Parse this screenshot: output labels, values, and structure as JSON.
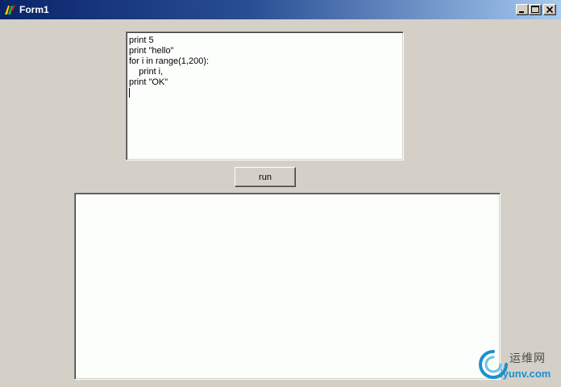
{
  "window": {
    "title": "Form1"
  },
  "caption_buttons": {
    "minimize_icon": "minimize-icon",
    "maximize_icon": "maximize-icon",
    "close_icon": "close-icon"
  },
  "editor": {
    "lines": [
      "print 5",
      "print \"hello\"",
      "for i in range(1,200):",
      "    print i,",
      "print \"OK\"",
      ""
    ]
  },
  "run_button": {
    "label": "run"
  },
  "output": {
    "text": ""
  },
  "watermark": {
    "text_cn": "运维网",
    "url": "iyunv.com"
  },
  "colors": {
    "form_background": "#d4d0c8",
    "titlebar_start": "#0a246a",
    "titlebar_end": "#a6caf0",
    "textbox_background": "#fcfefc",
    "watermark_blue": "#1a8fd0"
  }
}
